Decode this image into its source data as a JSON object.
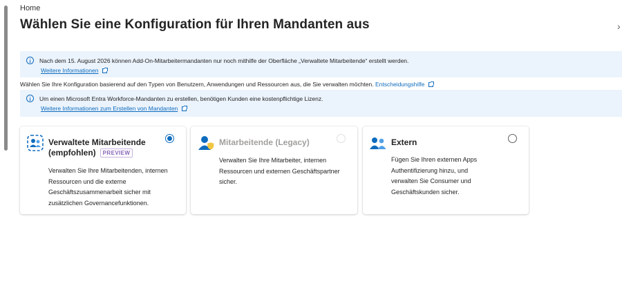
{
  "breadcrumb": {
    "home": "Home"
  },
  "header": {
    "title": "Wählen Sie eine Konfiguration für Ihren Mandanten aus",
    "more": "···",
    "close": "›"
  },
  "banner1": {
    "text": "Nach dem 15. August 2026 können Add-On-Mitarbeitermandanten nur noch mithilfe der Oberfläche „Verwaltete Mitarbeitende“ erstellt werden.",
    "link": "Weitere Informationen"
  },
  "description": {
    "text": "Wählen Sie Ihre Konfiguration basierend auf den Typen von Benutzern, Anwendungen und Ressourcen aus, die Sie verwalten möchten.",
    "link": "Entscheidungshilfe"
  },
  "banner2": {
    "text": "Um einen Microsoft Entra Workforce-Mandanten zu erstellen, benötigen Kunden eine kostenpflichtige Lizenz.",
    "link": "Weitere Informationen zum Erstellen von Mandanten"
  },
  "cards": [
    {
      "title": "Verwaltete Mitarbeitende",
      "subtitle": "(empfohlen)",
      "badge": "PREVIEW",
      "body": "Verwalten Sie Ihre Mitarbeitenden, internen Ressourcen und die externe Geschäftszusammenarbeit sicher mit zusätzlichen Governancefunktionen.",
      "selected": true,
      "icon": "managed-workforce-icon"
    },
    {
      "title": "Mitarbeitende (Legacy)",
      "body": "Verwalten Sie Ihre Mitarbeiter, internen Ressourcen und externen Geschäftspartner sicher.",
      "selected": false,
      "disabled": true,
      "icon": "workforce-legacy-icon"
    },
    {
      "title": "Extern",
      "body": "Fügen Sie Ihren externen Apps Authentifizierung hinzu, und verwalten Sie Consumer und Geschäftskunden sicher.",
      "selected": false,
      "icon": "external-users-icon"
    }
  ],
  "colors": {
    "accent": "#0f6cbd",
    "banner_bg": "#ebf3fc",
    "preview": "#8764b8",
    "disabled": "#a19f9d"
  }
}
